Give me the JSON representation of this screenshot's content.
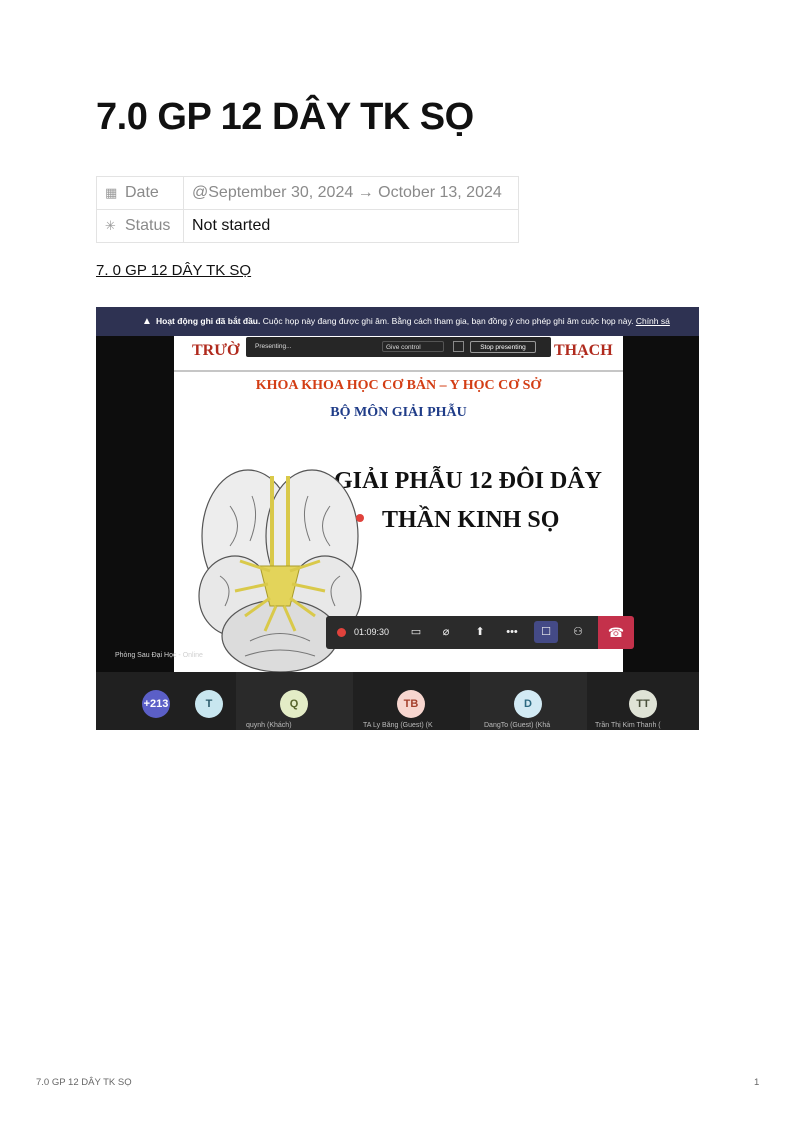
{
  "page": {
    "title": "7.0 GP 12 DÂY TK SỌ",
    "properties": [
      {
        "key": "Date",
        "icon": "calendar-icon",
        "value": "@September 30, 2024 → October 13, 2024"
      },
      {
        "key": "Status",
        "icon": "status-icon",
        "value": "Not started"
      }
    ],
    "link_text": "7. 0 GP 12 DÂY TK SỌ"
  },
  "screenshot": {
    "recording_banner": {
      "bold": "Hoạt động ghi đã bắt đầu.",
      "text": "Cuộc họp này đang được ghi âm. Bằng cách tham gia, bạn đồng ý cho phép ghi âm cuộc họp này.",
      "link": "Chính sá"
    },
    "presenting_bar": {
      "status": "Presenting...",
      "give_control": "Give control",
      "stop": "Stop presenting"
    },
    "slide": {
      "school_left": "TRƯỜ",
      "school_right": "THẠCH",
      "faculty": "KHOA KHOA HỌC CƠ BẢN – Y HỌC CƠ SỞ",
      "department": "BỘ MÔN GIẢI PHẪU",
      "title_line1": "GIẢI PHẪU 12 ĐÔI DÂY",
      "title_line2": "THẦN KINH SỌ"
    },
    "controls": {
      "timer": "01:09:30"
    },
    "room_label": "Phòng Sau Đại Học - Online",
    "participants": [
      {
        "initials": "+213",
        "name": "",
        "bg": "#5b5fc7",
        "fg": "#ffffff"
      },
      {
        "initials": "T",
        "name": "",
        "bg": "#c8e6ef",
        "fg": "#2a5a6a"
      },
      {
        "initials": "Q",
        "name": "quynh (Khách)",
        "bg": "#e3ecc6",
        "fg": "#55632a"
      },
      {
        "initials": "TB",
        "name": "TA Ly Băng (Guest) (K",
        "bg": "#f7d6cf",
        "fg": "#a4402c"
      },
      {
        "initials": "D",
        "name": "DangTo (Guest) (Khá",
        "bg": "#d2eaf4",
        "fg": "#2c6a82"
      },
      {
        "initials": "TT",
        "name": "Trần Thị Kim Thanh (",
        "bg": "#dfe3d6",
        "fg": "#4a513c"
      }
    ]
  },
  "footer": {
    "left": "7.0 GP 12 DÂY TK SỌ",
    "page_number": "1"
  }
}
